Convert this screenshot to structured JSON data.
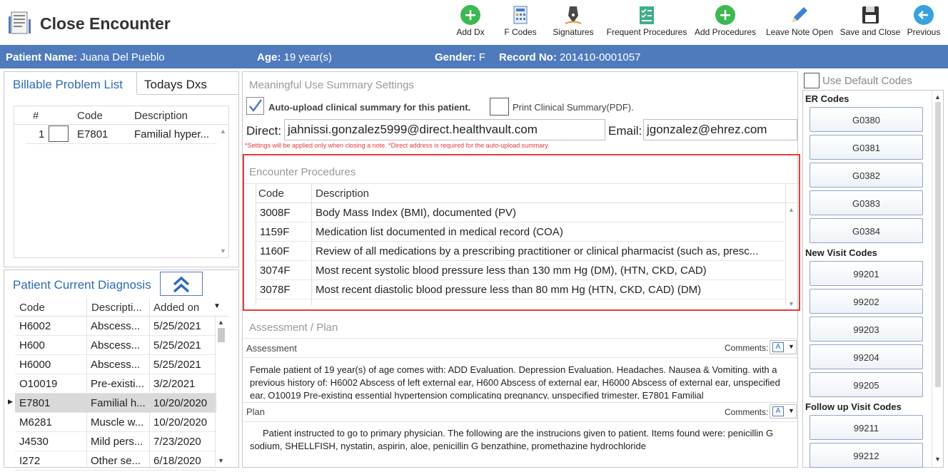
{
  "window": {
    "title": "Close Encounter"
  },
  "toolbar": {
    "add_dx": "Add Dx",
    "f_codes": "F Codes",
    "signatures": "Signatures",
    "frequent_procedures": "Frequent Procedures",
    "add_procedures": "Add Procedures",
    "leave_note_open": "Leave Note Open",
    "save_and_close": "Save and Close",
    "previous": "Previous"
  },
  "patient": {
    "name_label": "Patient Name:",
    "name": "Juana Del Pueblo",
    "age_label": "Age:",
    "age": "19 year(s)",
    "gender_label": "Gender:",
    "gender": "F",
    "record_label": "Record No:",
    "record": "201410-0001057"
  },
  "problem_list": {
    "tabs": [
      "Billable Problem List",
      "Todays Dxs"
    ],
    "headers": [
      "#",
      "Code",
      "Description"
    ],
    "rows": [
      {
        "num": "1",
        "code": "E7801",
        "description": "Familial hyper..."
      }
    ]
  },
  "current_diagnosis": {
    "title": "Patient Current Diagnosis",
    "headers": [
      "Code",
      "Descripti...",
      "Added on"
    ],
    "rows": [
      {
        "code": "H6002",
        "description": "Abscess...",
        "added": "5/25/2021"
      },
      {
        "code": "H600",
        "description": "Abscess...",
        "added": "5/25/2021"
      },
      {
        "code": "H6000",
        "description": "Abscess...",
        "added": "5/25/2021"
      },
      {
        "code": "O10019",
        "description": "Pre-existi...",
        "added": "3/2/2021"
      },
      {
        "code": "E7801",
        "description": "Familial h...",
        "added": "10/20/2020"
      },
      {
        "code": "M6281",
        "description": "Muscle w...",
        "added": "10/20/2020"
      },
      {
        "code": "J4530",
        "description": "Mild pers...",
        "added": "7/23/2020"
      },
      {
        "code": "I272",
        "description": "Other se...",
        "added": "6/18/2020"
      }
    ]
  },
  "meaningful_use": {
    "title": "Meaningful Use Summary Settings",
    "auto_upload_label": "Auto-upload clinical summary for this patient.",
    "print_summary_label": "Print Clinical Summary(PDF).",
    "direct_label": "Direct:",
    "direct_value": "jahnissi.gonzalez5999@direct.healthvault.com",
    "email_label": "Email:",
    "email_value": "jgonzalez@ehrez.com",
    "note": "*Settings will be applied only when closing a note.   *Direct address is required for the auto-upload summary."
  },
  "encounter_procedures": {
    "title": "Encounter Procedures",
    "headers": [
      "Code",
      "Description"
    ],
    "rows": [
      {
        "code": "3008F",
        "description": "Body Mass Index (BMI), documented (PV)"
      },
      {
        "code": "1159F",
        "description": "Medication list documented in medical record (COA)"
      },
      {
        "code": "1160F",
        "description": "Review of all medications by a prescribing practitioner or clinical pharmacist (such as, presc..."
      },
      {
        "code": "3074F",
        "description": "Most recent systolic blood pressure less than 130 mm Hg (DM), (HTN, CKD, CAD)"
      },
      {
        "code": "3078F",
        "description": "Most recent diastolic blood pressure less than 80 mm Hg (HTN, CKD, CAD) (DM)"
      }
    ]
  },
  "assessment_plan": {
    "title": "Assessment / Plan",
    "assessment_label": "Assessment",
    "comments_label": "Comments:",
    "assessment_text": "Female patient of 19 year(s) of age comes with: ADD Evaluation. Depression Evaluation. Headaches. Nausea & Vomiting. with a previous history of: H6002 Abscess of left external ear, H600 Abscess of external ear, H6000 Abscess of external ear, unspecified ear, O10019 Pre-existing essential hypertension complicating pregnancy, unspecified trimester, E7801 Familial",
    "plan_label": "Plan",
    "plan_text": "Patient instructed to go to primary physician.  The following are the instrucions given to patient.     Items found were: penicillin G sodium, SHELLFISH, nystatin, aspirin, aloe, penicillin G benzathine, promethazine hydrochloride"
  },
  "codes_sidebar": {
    "use_default_label": "Use Default Codes",
    "er_label": "ER Codes",
    "er_codes": [
      "G0380",
      "G0381",
      "G0382",
      "G0383",
      "G0384"
    ],
    "new_visit_label": "New Visit Codes",
    "new_visit_codes": [
      "99201",
      "99202",
      "99203",
      "99204",
      "99205"
    ],
    "follow_up_label": "Follow up Visit Codes",
    "follow_up_codes": [
      "99211",
      "99212"
    ]
  },
  "colors": {
    "accent": "#4f7bbd",
    "highlight": "#e23b3b",
    "green": "#3cb950"
  }
}
